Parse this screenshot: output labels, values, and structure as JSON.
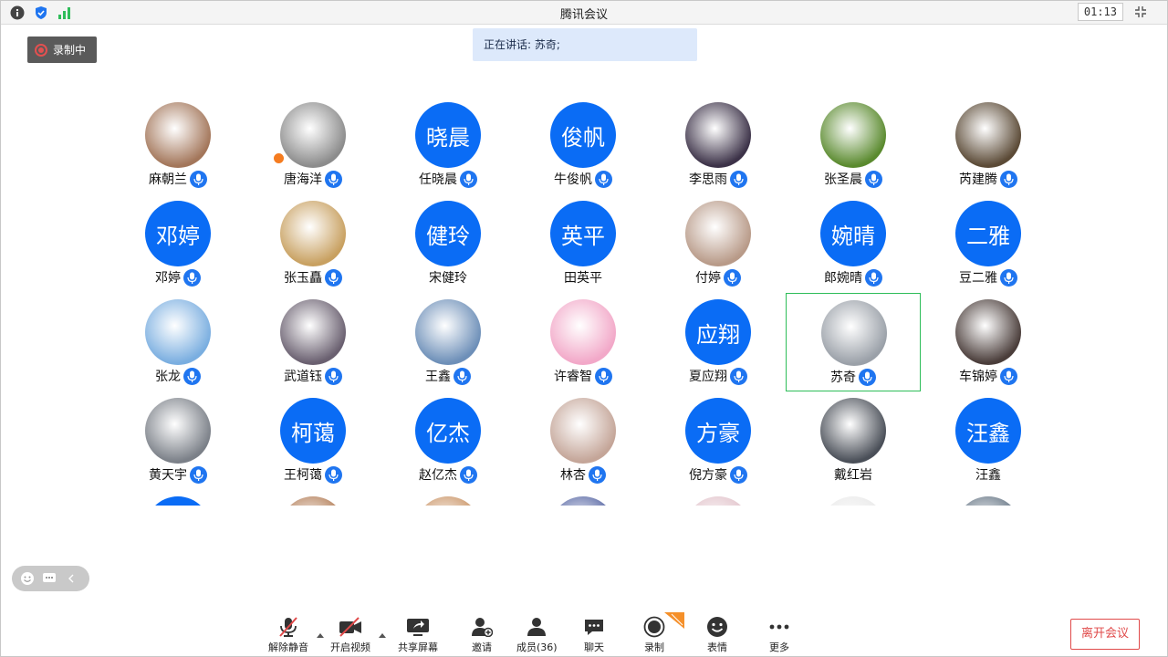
{
  "window": {
    "title": "腾讯会议",
    "timer": "01:13"
  },
  "recording_badge": "录制中",
  "speaking": "正在讲话: 苏奇;",
  "participants": [
    {
      "name": "麻朝兰",
      "avatar": "photo",
      "color": "#a3765a",
      "mic": true
    },
    {
      "name": "唐海洋",
      "avatar": "photo",
      "color": "#8c8c8c",
      "mic": true,
      "host": true
    },
    {
      "name": "任晓晨",
      "avatar": "晓晨",
      "mic": true
    },
    {
      "name": "牛俊帆",
      "avatar": "俊帆",
      "mic": true
    },
    {
      "name": "李思雨",
      "avatar": "photo",
      "color": "#3c3248",
      "mic": true
    },
    {
      "name": "张圣晨",
      "avatar": "photo",
      "color": "#5a8a2e",
      "mic": true
    },
    {
      "name": "芮建腾",
      "avatar": "photo",
      "color": "#5b4a36",
      "mic": true
    },
    {
      "name": "邓婷",
      "avatar": "邓婷",
      "mic": true
    },
    {
      "name": "张玉矗",
      "avatar": "photo",
      "color": "#c8a060",
      "mic": true
    },
    {
      "name": "宋健玲",
      "avatar": "健玲",
      "mic": false
    },
    {
      "name": "田英平",
      "avatar": "英平",
      "mic": false
    },
    {
      "name": "付婷",
      "avatar": "photo",
      "color": "#b89a88",
      "mic": true
    },
    {
      "name": "郎婉晴",
      "avatar": "婉晴",
      "mic": true
    },
    {
      "name": "豆二雅",
      "avatar": "二雅",
      "mic": true
    },
    {
      "name": "张龙",
      "avatar": "photo",
      "color": "#7aaee0",
      "mic": true
    },
    {
      "name": "武道钰",
      "avatar": "photo",
      "color": "#6a6070",
      "mic": true
    },
    {
      "name": "王鑫",
      "avatar": "photo",
      "color": "#6d8fb8",
      "mic": true
    },
    {
      "name": "许睿智",
      "avatar": "photo",
      "color": "#f2a8c8",
      "mic": true
    },
    {
      "name": "夏应翔",
      "avatar": "应翔",
      "mic": true
    },
    {
      "name": "苏奇",
      "avatar": "photo",
      "color": "#9aa0a8",
      "mic": true,
      "active": true
    },
    {
      "name": "车锦婷",
      "avatar": "photo",
      "color": "#4a3d3a",
      "mic": true
    },
    {
      "name": "黄天宇",
      "avatar": "photo",
      "color": "#7b8088",
      "mic": true
    },
    {
      "name": "王柯蔼",
      "avatar": "柯蔼",
      "mic": true
    },
    {
      "name": "赵亿杰",
      "avatar": "亿杰",
      "mic": true
    },
    {
      "name": "林杏",
      "avatar": "photo",
      "color": "#c4a598",
      "mic": true
    },
    {
      "name": "倪方豪",
      "avatar": "方豪",
      "mic": true
    },
    {
      "name": "戴红岩",
      "avatar": "photo",
      "color": "#4a4f58",
      "mic": false
    },
    {
      "name": "汪鑫",
      "avatar": "汪鑫",
      "mic": false
    },
    {
      "name": "",
      "avatar": "blue",
      "mic": false
    },
    {
      "name": "",
      "avatar": "photo",
      "color": "#b07850",
      "mic": false
    },
    {
      "name": "",
      "avatar": "photo",
      "color": "#c89060",
      "mic": false
    },
    {
      "name": "",
      "avatar": "photo",
      "color": "#5060a0",
      "mic": false
    },
    {
      "name": "",
      "avatar": "photo",
      "color": "#e0c0c8",
      "mic": false
    },
    {
      "name": "",
      "avatar": "photo",
      "color": "#e8e8e8",
      "mic": false
    },
    {
      "name": "",
      "avatar": "photo",
      "color": "#607080",
      "mic": false
    }
  ],
  "toolbar": {
    "unmute": "解除静音",
    "video": "开启视频",
    "share": "共享屏幕",
    "invite": "邀请",
    "members": "成员(36)",
    "chat": "聊天",
    "record": "录制",
    "emoji": "表情",
    "more": "更多",
    "leave": "离开会议"
  },
  "colors": {
    "accent": "#0a6cf5",
    "active_border": "#2ebd59",
    "leave": "#e04a4a"
  }
}
